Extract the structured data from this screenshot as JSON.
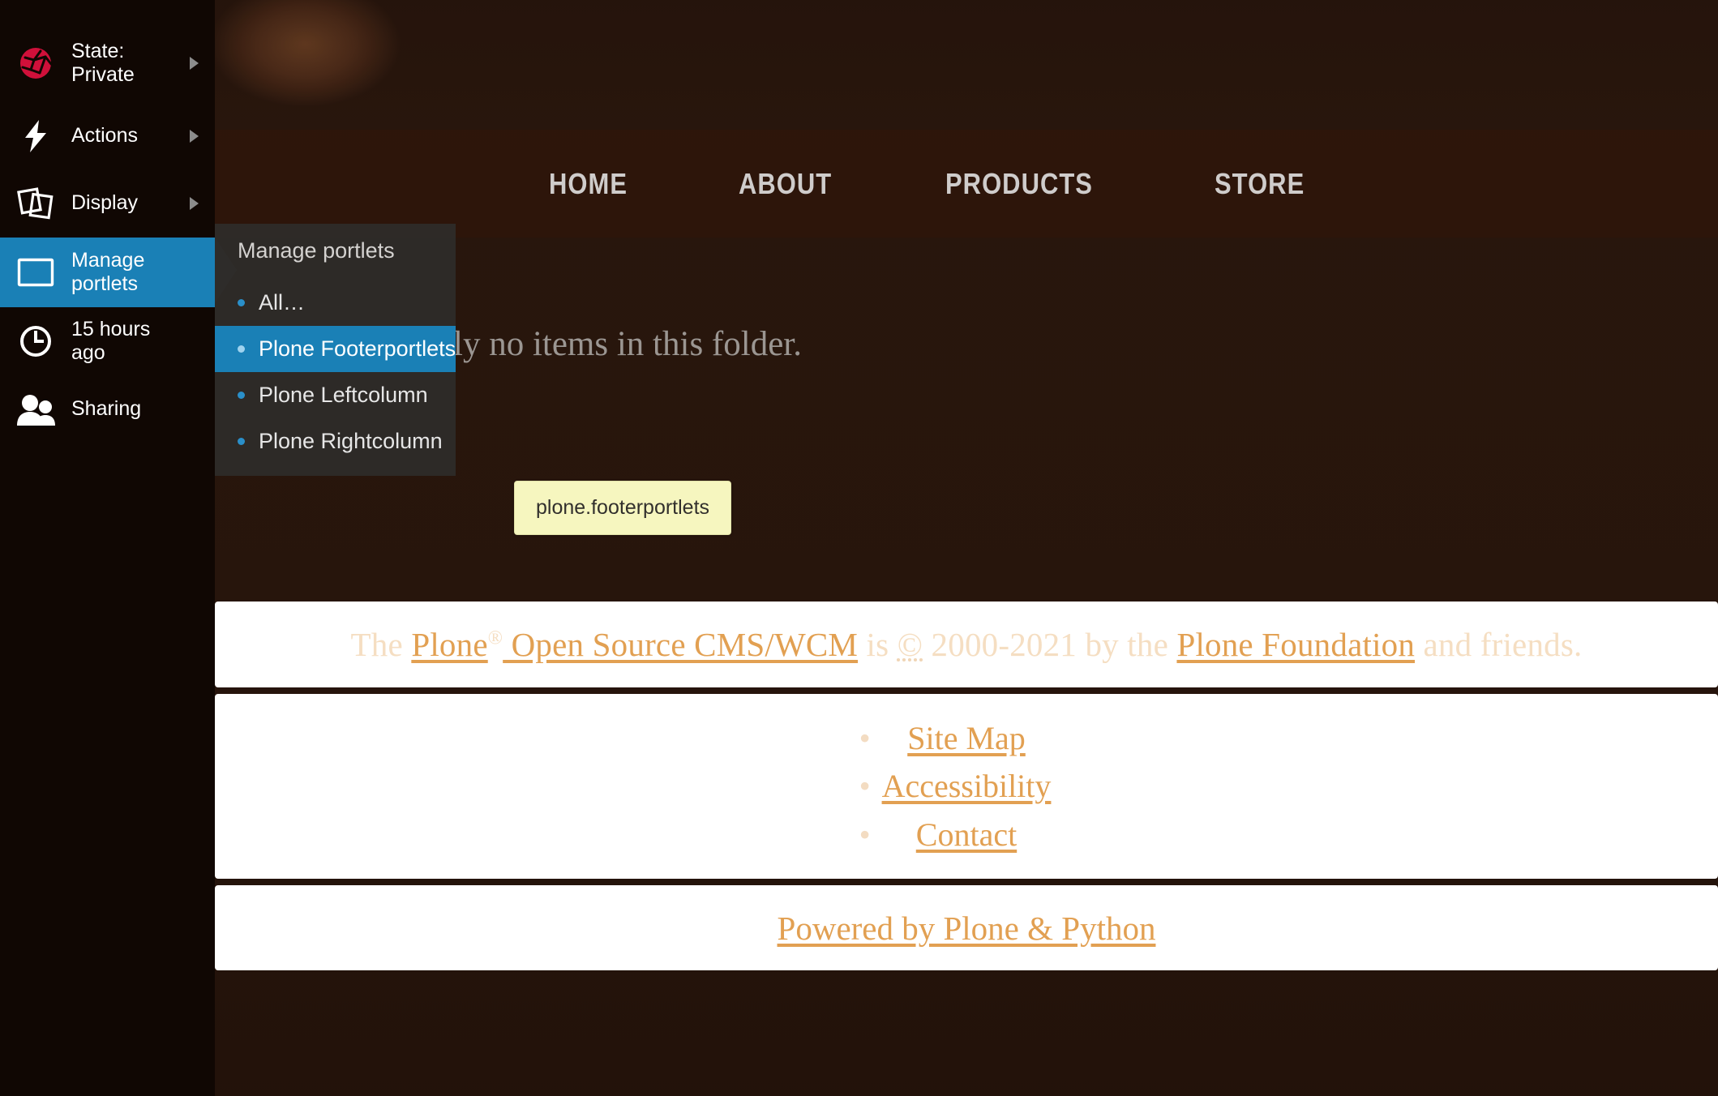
{
  "toolbar": {
    "items": [
      {
        "id": "state",
        "label": "State:\nPrivate",
        "icon": "state-private-icon",
        "has_submenu": true,
        "active": false
      },
      {
        "id": "actions",
        "label": "Actions",
        "icon": "lightning-bolt-icon",
        "has_submenu": true,
        "active": false
      },
      {
        "id": "display",
        "label": "Display",
        "icon": "display-layers-icon",
        "has_submenu": true,
        "active": false
      },
      {
        "id": "manage",
        "label": "Manage portlets",
        "icon": "portlets-rectangle-icon",
        "has_submenu": false,
        "active": true
      },
      {
        "id": "history",
        "label": "15 hours ago",
        "icon": "clock-icon",
        "has_submenu": false,
        "active": false
      },
      {
        "id": "sharing",
        "label": "Sharing",
        "icon": "users-icon",
        "has_submenu": false,
        "active": false
      }
    ]
  },
  "dropdown": {
    "title": "Manage portlets",
    "items": [
      {
        "label": "All…",
        "selected": false
      },
      {
        "label": "Plone Footerportlets",
        "selected": true
      },
      {
        "label": "Plone Leftcolumn",
        "selected": false
      },
      {
        "label": "Plone Rightcolumn",
        "selected": false
      }
    ]
  },
  "tooltip": {
    "text": "plone.footerportlets"
  },
  "nav": {
    "items": [
      {
        "label": "HOME"
      },
      {
        "label": "ABOUT"
      },
      {
        "label": "PRODUCTS"
      },
      {
        "label": "STORE"
      }
    ]
  },
  "content": {
    "empty_message": "There are currently no items in this folder."
  },
  "footer": {
    "copyright": {
      "prefix": "The ",
      "link_plone": "Plone",
      "registered_mark": "®",
      "link_oss_cms": " Open Source CMS/WCM",
      "middle": " is ",
      "copyright_symbol": "©",
      "years": " 2000-2021 by the ",
      "link_foundation": "Plone Foundation",
      "suffix": " and friends."
    },
    "links": [
      {
        "label": "Site Map"
      },
      {
        "label": "Accessibility"
      },
      {
        "label": "Contact"
      }
    ],
    "powered": {
      "label": "Powered by Plone & Python"
    }
  },
  "colors": {
    "accent_blue": "#1a80b6",
    "toolbar_bg": "#100703",
    "dropdown_bg": "#2e2c2a",
    "tooltip_bg": "#f6f6bf",
    "link_orange": "#e2a052",
    "state_private_red": "#d0103a"
  }
}
